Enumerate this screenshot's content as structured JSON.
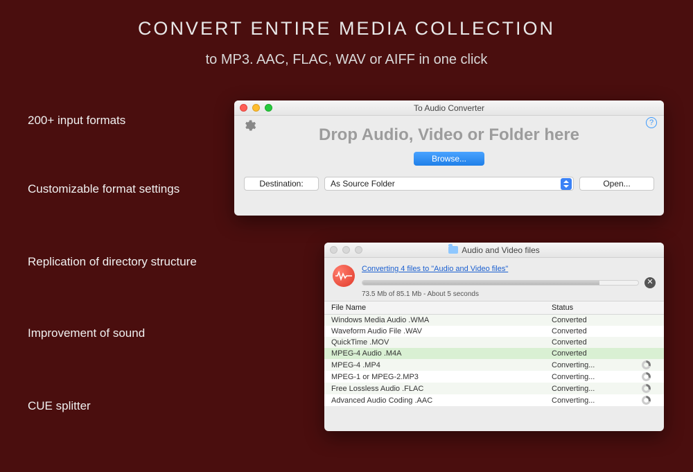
{
  "headline": "CONVERT  ENTIRE  MEDIA  COLLECTION",
  "subheadline": "to MP3. AAC, FLAC, WAV or AIFF in one click",
  "features": [
    "200+ input formats",
    "Customizable format settings",
    "Replication of directory structure",
    "Improvement of sound",
    "CUE splitter"
  ],
  "window1": {
    "title": "To Audio Converter",
    "drop_text": "Drop Audio, Video or Folder here",
    "browse": "Browse...",
    "destination_btn": "Destination:",
    "destination_value": "As Source Folder",
    "open_btn": "Open...",
    "help": "?"
  },
  "window2": {
    "title": "Audio and Video files",
    "converting_link": "Converting 4 files to \"Audio and Video files\"",
    "progress_text": "73.5 Mb of 85.1 Mb - About 5 seconds",
    "cancel": "✕",
    "columns": {
      "name": "File Name",
      "status": "Status"
    },
    "rows": [
      {
        "name": "Windows Media Audio .WMA",
        "status": "Converted",
        "spinning": false
      },
      {
        "name": "Waveform Audio File .WAV",
        "status": "Converted",
        "spinning": false
      },
      {
        "name": "QuickTime .MOV",
        "status": "Converted",
        "spinning": false
      },
      {
        "name": "MPEG-4 Audio .M4A",
        "status": "Converted",
        "spinning": false,
        "selected": true
      },
      {
        "name": "MPEG-4 .MP4",
        "status": "Converting...",
        "spinning": true
      },
      {
        "name": "MPEG-1 or MPEG-2.MP3",
        "status": "Converting...",
        "spinning": true
      },
      {
        "name": "Free Lossless Audio .FLAC",
        "status": "Converting...",
        "spinning": true
      },
      {
        "name": "Advanced Audio Coding .AAC",
        "status": "Converting...",
        "spinning": true
      }
    ]
  }
}
